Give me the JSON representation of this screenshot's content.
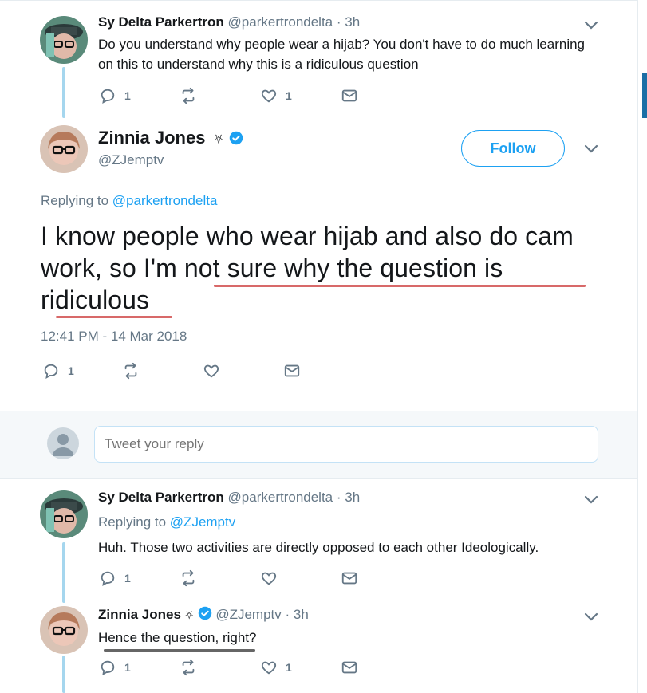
{
  "tweets": [
    {
      "name": "Sy Delta Parkertron",
      "handle": "@parkertrondelta",
      "time": "· 3h",
      "text": "Do you understand why people wear a hijab? You don't have to do much learning on this to understand why this is a ridiculous question",
      "reply_count": "1",
      "retweet_count": "",
      "like_count": "1"
    },
    {
      "name": "Sy Delta Parkertron",
      "handle": "@parkertrondelta",
      "time": "· 3h",
      "replying_prefix": "Replying to",
      "replying_to": "@ZJemptv",
      "text": "Huh. Those two activities are directly opposed to each other Ideologically.",
      "reply_count": "1",
      "retweet_count": "",
      "like_count": ""
    },
    {
      "name": "Zinnia Jones",
      "name_symbol": "⛧",
      "handle": "@ZJemptv",
      "time": "· 3h",
      "text": "Hence the question, right?",
      "reply_count": "1",
      "retweet_count": "",
      "like_count": "1"
    }
  ],
  "main_tweet": {
    "name": "Zinnia Jones",
    "name_symbol": "⛧",
    "handle": "@ZJemptv",
    "follow_label": "Follow",
    "replying_prefix": "Replying to",
    "replying_to": "@parkertrondelta",
    "text": "I know people who wear hijab and also do cam work, so I'm not sure why the question is ridiculous",
    "date": "12:41 PM - 14 Mar 2018",
    "reply_count": "1",
    "retweet_count": "",
    "like_count": ""
  },
  "reply_box": {
    "placeholder": "Tweet your reply"
  },
  "colors": {
    "accent": "#1da1f2",
    "muted": "#657786",
    "thread_line": "#a5d6ee",
    "verified": "#1da1f2"
  }
}
